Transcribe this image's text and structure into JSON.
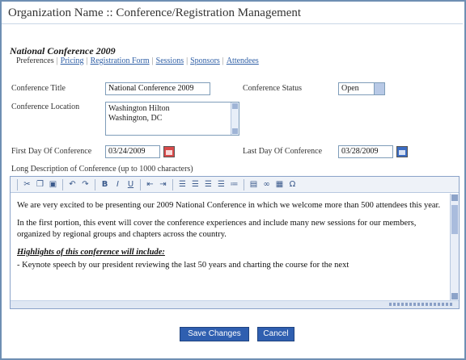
{
  "window": {
    "title": "Organization Name :: Conference/Registration Management"
  },
  "conference": {
    "name": "National Conference 2009"
  },
  "subnav": {
    "current": "Preferences",
    "links": [
      "Pricing",
      "Registration Form",
      "Sessions",
      "Sponsors",
      "Attendees"
    ]
  },
  "form": {
    "conf_title_label": "Conference Title",
    "conf_title_value": "National Conference 2009",
    "conf_status_label": "Conference Status",
    "conf_status_value": "Open",
    "conf_location_label": "Conference Location",
    "conf_location_lines": [
      "Washington Hilton",
      "Washington, DC"
    ],
    "first_day_label": "First Day Of Conference",
    "first_day_value": "03/24/2009",
    "last_day_label": "Last Day Of Conference",
    "last_day_value": "03/28/2009",
    "description_label": "Long Description of Conference (up to 1000 characters)"
  },
  "editor": {
    "paragraph1": "We are very excited to be presenting our 2009 National Conference in which we welcome more than 500 attendees this year.",
    "paragraph2": "In the first portion, this event will cover the conference experiences and include many new sessions for our members, organized by regional groups and chapters across the country.",
    "heading": "Highlights of this conference will include:",
    "bullet1": "- Keynote speech by our president reviewing the last 50 years and charting the course for the next"
  },
  "buttons": {
    "save": "Save Changes",
    "cancel": "Cancel"
  },
  "colors": {
    "frame": "#6e8fb3",
    "button": "#2f5fb0",
    "link": "#2f5fa6"
  }
}
